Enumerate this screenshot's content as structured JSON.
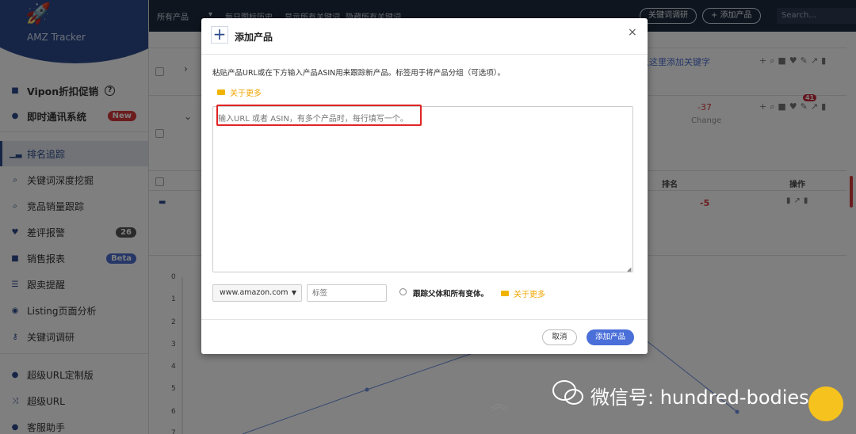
{
  "sidebar": {
    "logo_text": "AMZ Tracker",
    "items": [
      {
        "label": "Vipon折扣促销",
        "icon": "gift-icon"
      },
      {
        "label": "即时通讯系统",
        "icon": "chat-icon",
        "badge": "New"
      },
      {
        "label": "排名追踪",
        "icon": "bar-chart-icon"
      },
      {
        "label": "关键词深度挖掘",
        "icon": "search-icon"
      },
      {
        "label": "竞品销量跟踪",
        "icon": "search-icon"
      },
      {
        "label": "差评报警",
        "icon": "heart-icon",
        "badge": "26"
      },
      {
        "label": "销售报表",
        "icon": "gift-icon",
        "badge": "Beta"
      },
      {
        "label": "跟卖提醒",
        "icon": "list-icon"
      },
      {
        "label": "Listing页面分析",
        "icon": "eye-icon"
      },
      {
        "label": "关键词调研",
        "icon": "key-icon"
      },
      {
        "label": "超级URL定制版",
        "icon": "chat-icon"
      },
      {
        "label": "超级URL",
        "icon": "shuffle-icon"
      },
      {
        "label": "客服助手",
        "icon": "chat-icon"
      }
    ]
  },
  "topbar": {
    "filter_all": "所有产品",
    "filter_history": "每日图标历史",
    "show_keywords": "显示所有关键词",
    "hide_keywords": "隐藏所有关键词",
    "keyword_research_button": "关键词调研",
    "add_product_button": "+ 添加产品",
    "search_placeholder": "Search..."
  },
  "background": {
    "add_keyword_link": "点这里添加关键字",
    "change_value": "-37",
    "change_label": "Change",
    "heart_count": "41",
    "rank_header": "排名",
    "actions_header": "操作",
    "rank_value": "-5",
    "y_axis": [
      "0",
      "1",
      "2",
      "3",
      "4",
      "5",
      "6",
      "7"
    ]
  },
  "modal": {
    "title": "添加产品",
    "close": "×",
    "instructions": "粘贴产品URL或在下方输入产品ASIN用来跟踪新产品。标签用于将产品分组（可选项）。",
    "learn_more": "关于更多",
    "textarea_placeholder": "输入URL 或者 ASIN，有多个产品时，每行填写一个。",
    "marketplace_value": "www.amazon.com",
    "tag_placeholder": "标签",
    "track_variants_label": "跟踪父体和所有变体。",
    "learn_more_2": "关于更多",
    "cancel_button": "取消",
    "add_button": "添加产品"
  },
  "watermark": {
    "text": "微信号: hundred-bodies"
  },
  "colors": {
    "brand": "#2d4a8c",
    "primary_button": "#4a6fd9",
    "highlight": "#e02424",
    "learn_more": "#f0a500"
  }
}
